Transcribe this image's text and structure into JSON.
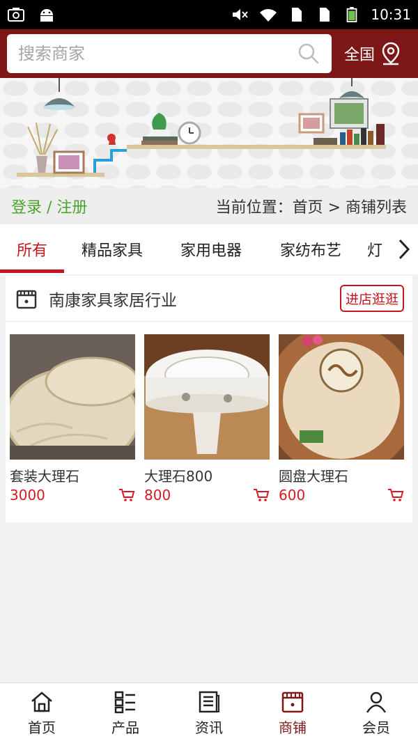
{
  "status_bar": {
    "time": "10:31"
  },
  "search": {
    "placeholder": "搜索商家"
  },
  "region": {
    "label": "全国"
  },
  "location_bar": {
    "login": "登录 / 注册",
    "breadcrumb": "当前位置：首页 > 商铺列表"
  },
  "tabs": [
    {
      "label": "所有",
      "active": true
    },
    {
      "label": "精品家具",
      "active": false
    },
    {
      "label": "家用电器",
      "active": false
    },
    {
      "label": "家纺布艺",
      "active": false
    },
    {
      "label": "灯",
      "active": false
    }
  ],
  "shop": {
    "name": "南康家具家居行业",
    "visit_label": "进店逛逛",
    "products": [
      {
        "name": "套装大理石",
        "price": "3000"
      },
      {
        "name": "大理石800",
        "price": "800"
      },
      {
        "name": "圆盘大理石",
        "price": "600"
      }
    ]
  },
  "bottom_nav": [
    {
      "label": "首页",
      "icon": "home-icon",
      "active": false
    },
    {
      "label": "产品",
      "icon": "product-grid-icon",
      "active": false
    },
    {
      "label": "资讯",
      "icon": "news-icon",
      "active": false
    },
    {
      "label": "商铺",
      "icon": "shop-icon",
      "active": true
    },
    {
      "label": "会员",
      "icon": "member-icon",
      "active": false
    }
  ],
  "colors": {
    "brand": "#7e1717",
    "accent_red": "#c4161c",
    "login_green": "#4aa62b"
  }
}
